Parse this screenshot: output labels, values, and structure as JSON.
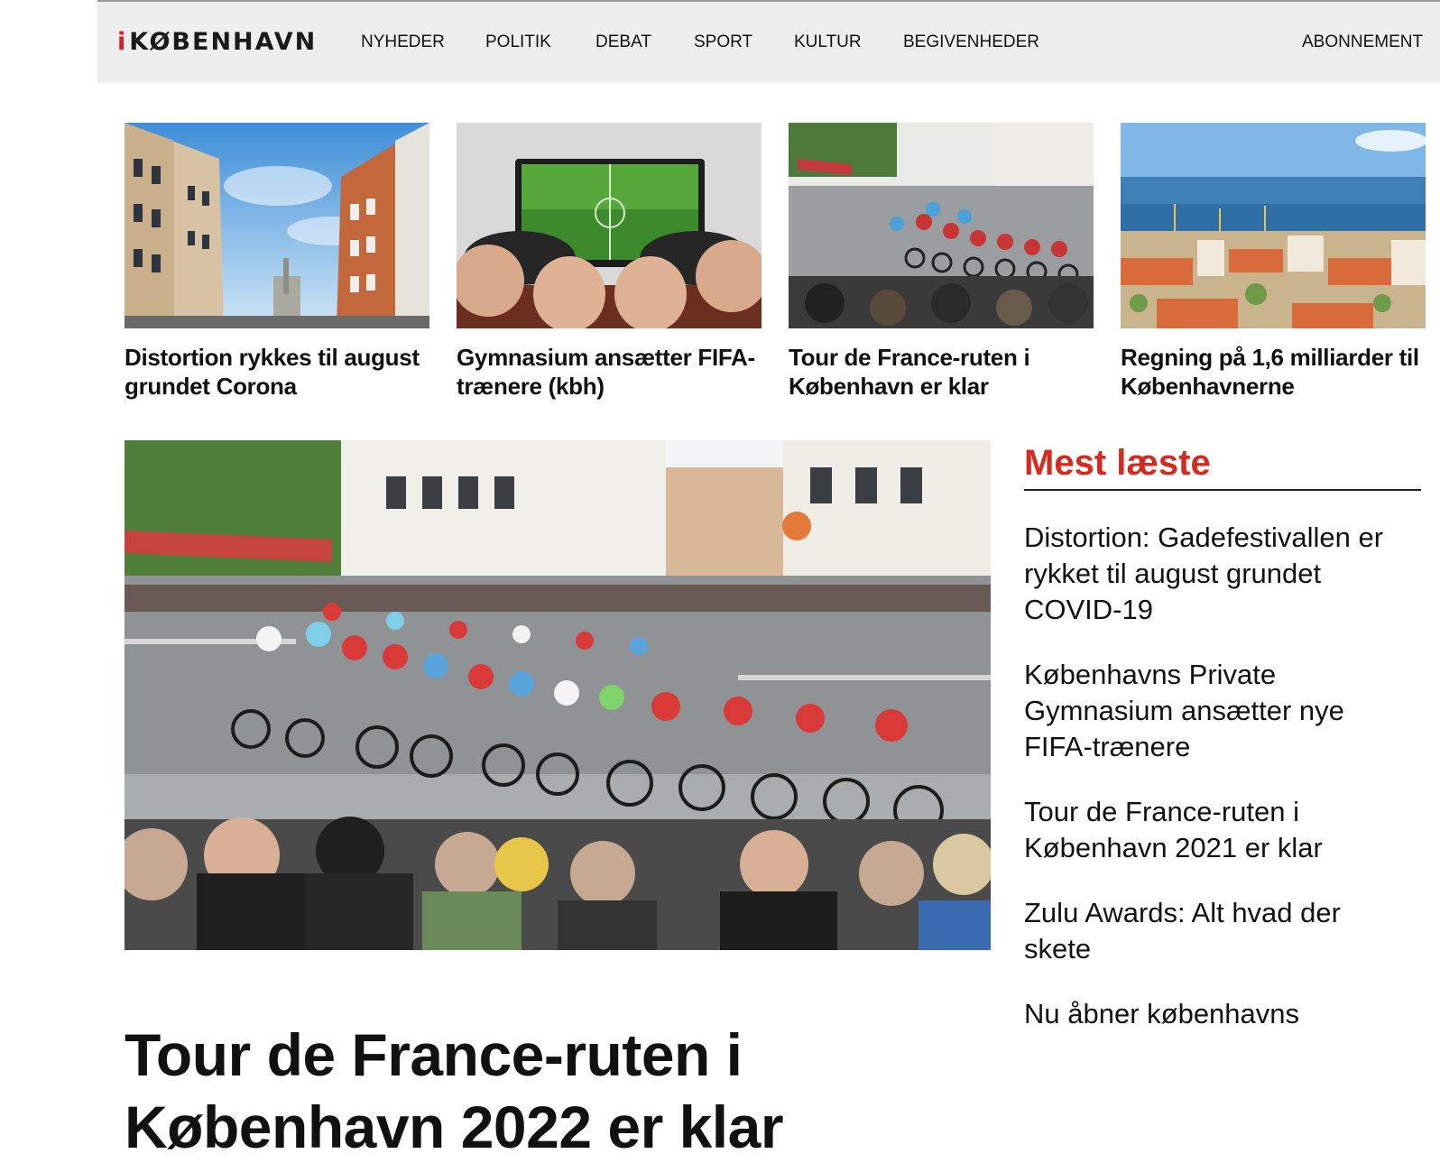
{
  "site": {
    "logo_mark": "i",
    "logo_text": "KØBENHAVN"
  },
  "nav": {
    "items": [
      "NYHEDER",
      "POLITIK",
      "DEBAT",
      "SPORT",
      "KULTUR",
      "BEGIVENHEDER"
    ],
    "subscription": "ABONNEMENT"
  },
  "cards": [
    {
      "headline": "Distortion rykkes til august grundet Corona",
      "image": "street-buildings-photo"
    },
    {
      "headline": "Gymnasium ansætter FIFA-trænere (kbh)",
      "image": "gaming-controllers-photo"
    },
    {
      "headline": "Tour de France-ruten i København er klar",
      "image": "cycling-race-photo"
    },
    {
      "headline": "Regning på 1,6 milliarder til Københavnerne",
      "image": "harbor-city-photo"
    }
  ],
  "featured": {
    "headline": "Tour de France-ruten i København 2022 er klar",
    "image": "cycling-race-photo"
  },
  "most_read": {
    "title": "Mest læste",
    "items": [
      "Distortion: Gadefestivallen er rykket til august grundet COVID-19",
      "Københavns Private Gymnasium ansætter nye FIFA-trænere",
      "Tour de France-ruten i København 2021 er klar",
      "Zulu Awards: Alt hvad der skete",
      "Nu åbner københavns"
    ]
  },
  "colors": {
    "accent_red": "#d42b20",
    "nav_background": "#eeeeee",
    "text": "#111111"
  }
}
